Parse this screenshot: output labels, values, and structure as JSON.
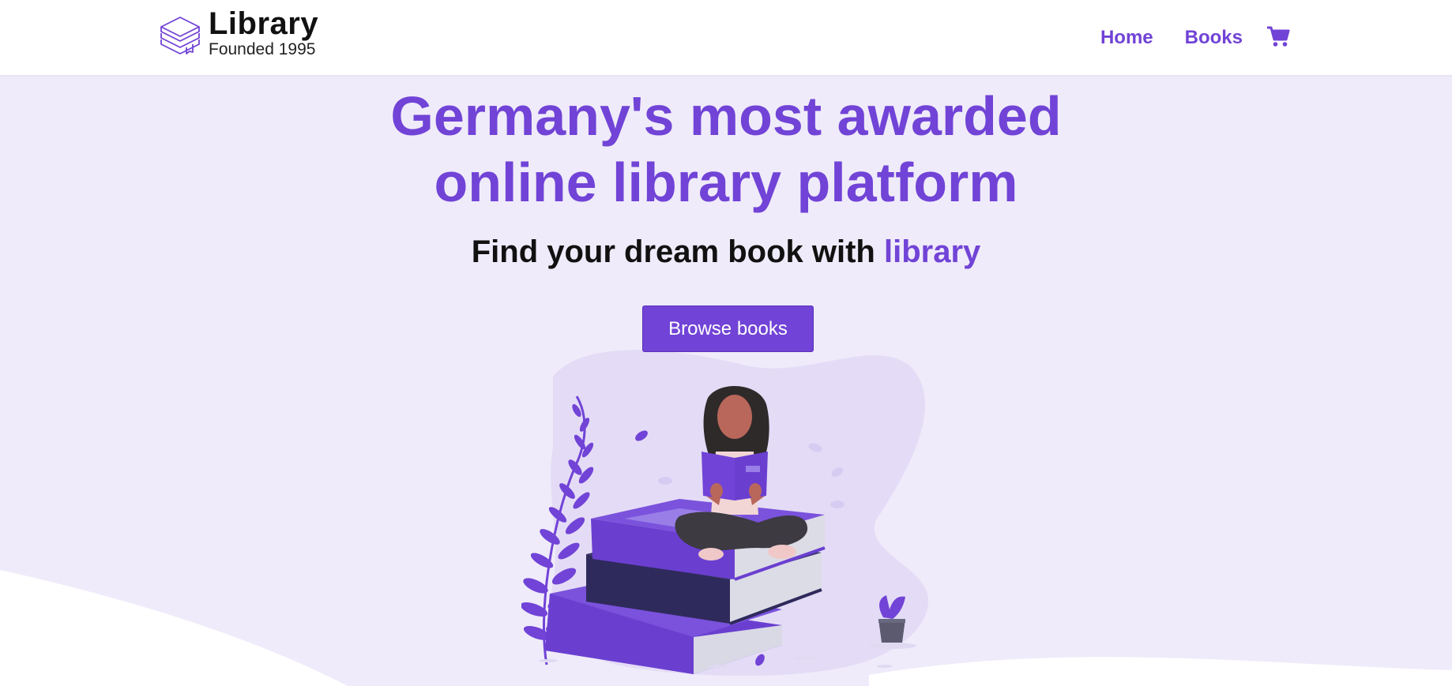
{
  "brand": {
    "title": "Library",
    "subtitle": "Founded 1995",
    "icon": "stacked-books-icon"
  },
  "nav": {
    "items": [
      {
        "label": "Home"
      },
      {
        "label": "Books"
      }
    ],
    "cart_icon": "shopping-cart-icon"
  },
  "hero": {
    "headline_line1": "Germany's most awarded",
    "headline_line2": "online library platform",
    "subheadline_prefix": "Find your dream book with ",
    "subheadline_accent": "library",
    "cta_label": "Browse books",
    "illustration": "woman-reading-on-book-stack"
  },
  "colors": {
    "accent": "#7143d6",
    "hero_background": "#efebfa",
    "text_dark": "#111111"
  }
}
